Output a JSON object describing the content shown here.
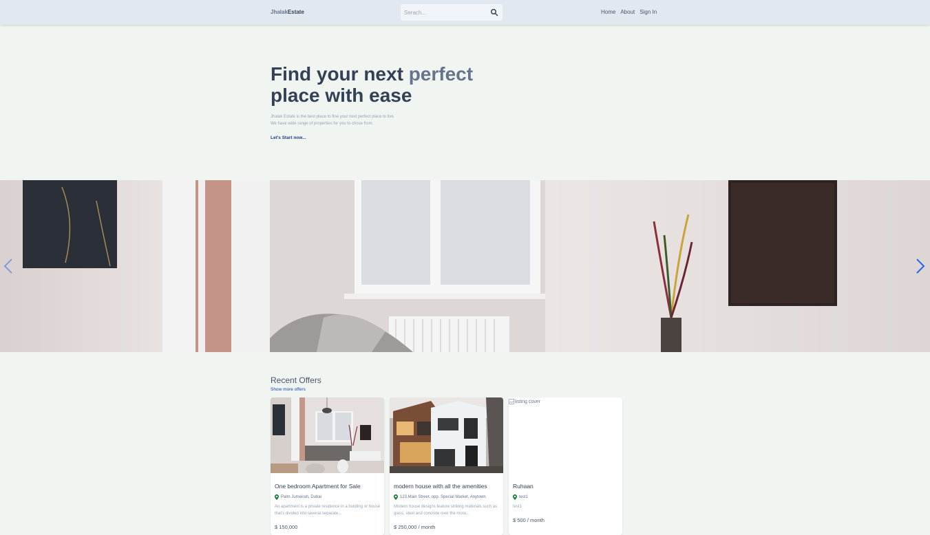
{
  "header": {
    "logo_part1": "Jhalak",
    "logo_part2": "Estate",
    "search_placeholder": "Serach...",
    "nav": [
      "Home",
      "About",
      "Sign In"
    ]
  },
  "hero": {
    "title_part1": "Find your next ",
    "title_accent": "perfect",
    "title_part2": "place with ease",
    "desc_line1": "Jhalak Estate is the best place to fine your next perfect place to live.",
    "desc_line2": "We have wide range of properties for you to chose from.",
    "cta": "Let's Start now..."
  },
  "offers": {
    "title": "Recent Offers",
    "link": "Show more offers",
    "cards": [
      {
        "title": "One bedroom Apartment for Sale",
        "location": "Palm Jumeirah, Dubai",
        "desc": "An apartment is a private residence in a building or house that's divided into several separate...",
        "price": "$ 150,000"
      },
      {
        "title": "modern house with all the amenities",
        "location": "123,Main Street, opp. Special Market, Anytown",
        "desc": "Modern house designs feature striking materials such as glass, steel and concrete over the more...",
        "price": "$ 250,000 / month"
      },
      {
        "title": "Ruhaan",
        "location": "test1",
        "desc": "test1",
        "price": "$ 500 / month",
        "image_alt": "listing cover"
      }
    ]
  },
  "colors": {
    "page_bg": "#f1f5f1",
    "header_bg": "#e2e8f0",
    "text_dark": "#334155",
    "accent": "#64748b",
    "pin_green": "#15803d",
    "arrow_blue": "#2563eb"
  }
}
